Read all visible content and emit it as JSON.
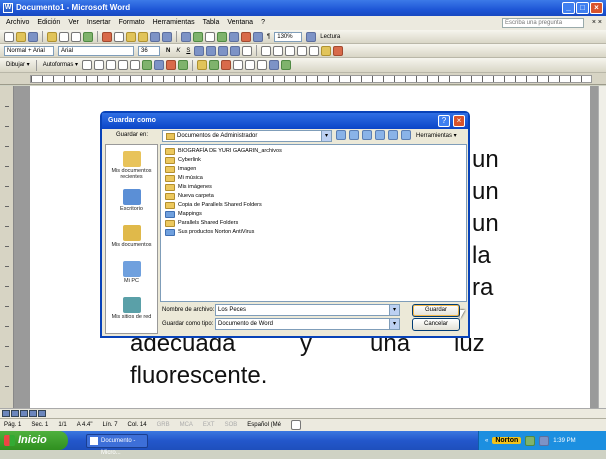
{
  "window": {
    "title": "Documento1 - Microsoft Word"
  },
  "menu": {
    "items": [
      "Archivo",
      "Edición",
      "Ver",
      "Insertar",
      "Formato",
      "Herramientas",
      "Tabla",
      "Ventana",
      "?"
    ],
    "help_placeholder": "Escriba una pregunta",
    "close_doc": "× ×"
  },
  "toolbar": {
    "zoom": "130%",
    "lectura": "Lectura",
    "style": "Normal + Arial",
    "font": "Arial",
    "size": "36",
    "bold": "N",
    "italic": "K",
    "underline": "S",
    "dibujo": "Dibujar ▾",
    "autoformas": "Autoformas ▾"
  },
  "document": {
    "lines": [
      "un",
      "un",
      "un",
      "la",
      "ra"
    ],
    "line6": [
      "adecuada",
      "y",
      "una",
      "luz"
    ],
    "line7": "fluorescente."
  },
  "dialog": {
    "title": "Guardar como",
    "lookin_label": "Guardar en:",
    "lookin_value": "Documentos de Administrador",
    "tools_label": "Herramientas ▾",
    "places": [
      {
        "label": "Mis documentos recientes",
        "color": "#e8c35a"
      },
      {
        "label": "Escritorio",
        "color": "#5b8fd6"
      },
      {
        "label": "Mis documentos",
        "color": "#e0b94a"
      },
      {
        "label": "Mi PC",
        "color": "#6fa0de"
      },
      {
        "label": "Mis sitios de red",
        "color": "#5aa0a8"
      }
    ],
    "files": [
      {
        "name": "BIOGRAFÍA DE YURI GAGARIN_archivos",
        "type": "folder"
      },
      {
        "name": "Cyberlink",
        "type": "folder"
      },
      {
        "name": "Imagen",
        "type": "folder"
      },
      {
        "name": "Mi música",
        "type": "folder"
      },
      {
        "name": "Mis imágenes",
        "type": "folder"
      },
      {
        "name": "Nueva carpeta",
        "type": "folder"
      },
      {
        "name": "Copia de Parallels Shared Folders",
        "type": "folder"
      },
      {
        "name": "Mappings",
        "type": "shortcut"
      },
      {
        "name": "Parallels Shared Folders",
        "type": "folder"
      },
      {
        "name": "Sus productos Norton AntiVirus",
        "type": "shortcut"
      }
    ],
    "filename_label": "Nombre de archivo:",
    "filename_value": "Los Peces",
    "filetype_label": "Guardar como tipo:",
    "filetype_value": "Documento de Word",
    "save_label": "Guardar",
    "cancel_label": "Cancelar"
  },
  "status": {
    "page": "Pág. 1",
    "section": "Sec. 1",
    "pages": "1/1",
    "at": "A 4.4\"",
    "line": "Lín. 7",
    "col": "Col. 14",
    "grb": "GRB",
    "mca": "MCA",
    "ext": "EXT",
    "sob": "SOB",
    "lang": "Español (Mé"
  },
  "taskbar": {
    "start": "Inicio",
    "task": "Documento - Micro...",
    "norton": "Norton",
    "time": "1:39 PM"
  }
}
